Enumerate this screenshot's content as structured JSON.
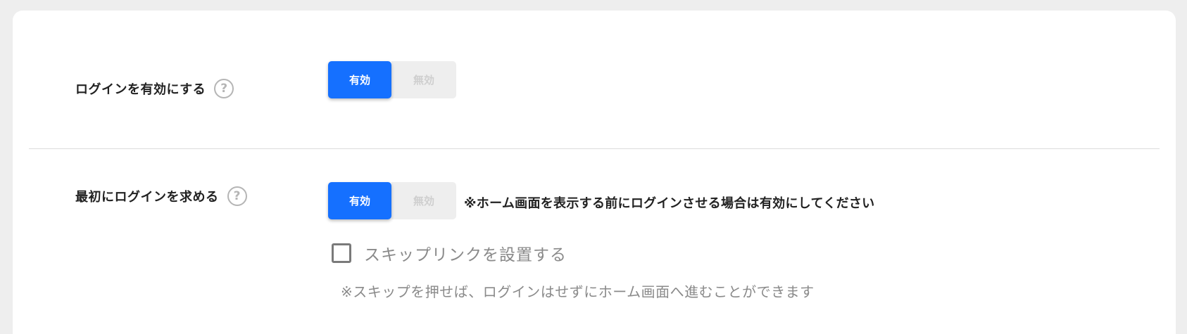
{
  "settings": {
    "login_enabled": {
      "label": "ログインを有効にする",
      "help_glyph": "?",
      "toggle_on": "有効",
      "toggle_off": "無効",
      "selected": "有効"
    },
    "require_login_first": {
      "label": "最初にログインを求める",
      "help_glyph": "?",
      "toggle_on": "有効",
      "toggle_off": "無効",
      "selected": "有効",
      "note": "※ホーム画面を表示する前にログインさせる場合は有効にしてください",
      "skip_link": {
        "label": "スキップリンクを設置する",
        "checked": false,
        "note": "※スキップを押せば、ログインはせずにホーム画面へ進むことができます"
      }
    }
  },
  "colors": {
    "accent": "#1570ff",
    "background": "#eeeeee",
    "card": "#ffffff",
    "text": "#222222",
    "muted": "#8a8a8a"
  }
}
